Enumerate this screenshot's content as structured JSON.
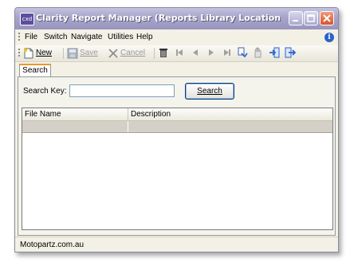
{
  "window": {
    "icon_text": "cxd",
    "title": "Clarity Report Manager (Reports Library Location = C:\\Pro..."
  },
  "menu": {
    "items": [
      "File",
      "Switch",
      "Navigate",
      "Utilities",
      "Help"
    ]
  },
  "toolbar": {
    "new_label": "New",
    "save_label": "Save",
    "cancel_label": "Cancel"
  },
  "tabs": [
    {
      "label": "Search",
      "selected": true
    }
  ],
  "search": {
    "label": "Search Key:",
    "input_value": "",
    "button_label": "Search"
  },
  "grid": {
    "columns": [
      "File Name",
      "Description"
    ],
    "rows": []
  },
  "status": {
    "text": "Motopartz.com.au"
  },
  "colors": {
    "title_bar": "#a6a4c8",
    "tab_highlight": "#e69a2d",
    "close_button": "#d9532b"
  }
}
